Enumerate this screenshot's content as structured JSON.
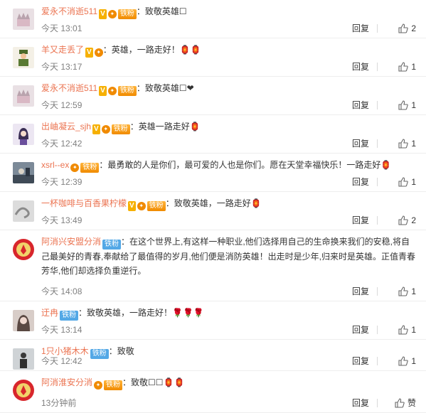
{
  "reply_label": "回复",
  "comments": [
    {
      "avatar": "cake",
      "user": "爱永不消逝511",
      "vip": "V",
      "fan_badge": "铁粉",
      "badge_style": "gold",
      "text": "：致敬英雄",
      "tail": "☐",
      "emoji": "",
      "time": "今天 13:01",
      "likes": "2"
    },
    {
      "avatar": "soldier",
      "user": "羊又走丢了",
      "vip": "V",
      "fan_badge": "",
      "badge_style": "gold",
      "text": "：英雄，一路走好！",
      "tail": "",
      "emoji": "🏮🏮",
      "time": "今天 13:17",
      "likes": "1"
    },
    {
      "avatar": "cake",
      "user": "爱永不消逝511",
      "vip": "V",
      "fan_badge": "铁粉",
      "badge_style": "gold",
      "text": "：致敬英雄",
      "tail": "☐",
      "emoji": "❤",
      "time": "今天 12:59",
      "likes": "1"
    },
    {
      "avatar": "girl",
      "user": "出岫凝云_sjh",
      "vip": "V",
      "fan_badge": "铁粉",
      "badge_style": "gold",
      "text": "：英雄一路走好",
      "tail": "",
      "emoji": "🏮",
      "time": "今天 12:42",
      "likes": "1"
    },
    {
      "avatar": "scene",
      "user": "xsrl--ex",
      "vip": "",
      "fan_badge": "铁粉",
      "badge_style": "gold",
      "text": "：最勇敢的人是你们，最可爱的人也是你们。愿在天堂幸福快乐！一路走好",
      "tail": "",
      "emoji": "🏮",
      "time": "今天 12:39",
      "likes": "1"
    },
    {
      "avatar": "swirl",
      "user": "一杯咖啡与百香果柠檬",
      "vip": "V",
      "fan_badge": "铁粉",
      "badge_style": "gold",
      "text": "：致敬英雄，一路走好",
      "tail": "",
      "emoji": "🏮",
      "time": "今天 13:49",
      "likes": "2"
    },
    {
      "avatar": "fire",
      "user": "阿消兴安盟分消",
      "vip": "",
      "fan_badge": "铁粉",
      "badge_style": "blue",
      "text": "：在这个世界上,有这样一种职业,他们选择用自己的生命换来我们的安稳,将自己最美好的青春,奉献给了最值得的岁月,他们便是消防英雄！出走时是少年,归来时是英雄。正值青春芳华,他们却选择负重逆行。",
      "tail": "",
      "emoji": "",
      "time": "今天 14:08",
      "likes": "1"
    },
    {
      "avatar": "face",
      "user": "迂冉",
      "vip": "",
      "fan_badge": "铁粉",
      "badge_style": "blue",
      "text": "：致敬英雄，一路走好！",
      "tail": "",
      "emoji": "🌹🌹🌹",
      "time": "今天 13:14",
      "likes": "1"
    },
    {
      "avatar": "person",
      "user": "1只小猪木木",
      "vip": "",
      "fan_badge": "铁粉",
      "badge_style": "blue",
      "text": "：致敬",
      "tail": "",
      "emoji": "",
      "time": "今天 12:42",
      "likes": "1"
    },
    {
      "avatar": "fire",
      "user": "阿消淮安分消",
      "vip": "",
      "fan_badge": "铁粉",
      "badge_style": "gold",
      "text": "：致敬",
      "tail": "☐☐",
      "emoji": "🏮🏮",
      "time": "13分钟前",
      "likes": "赞"
    }
  ]
}
